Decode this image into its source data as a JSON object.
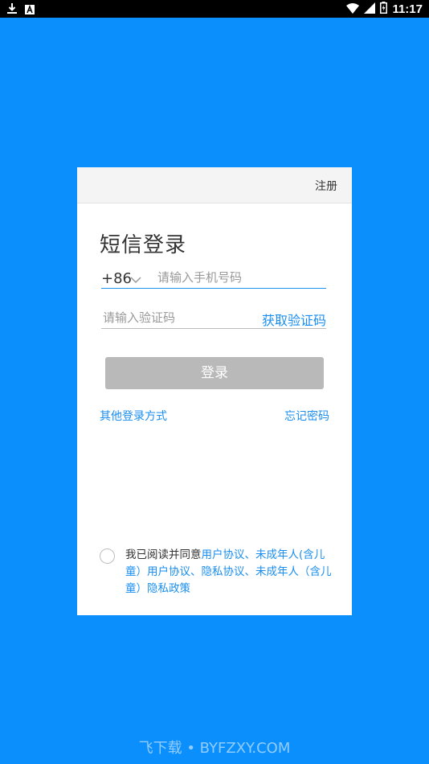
{
  "status_bar": {
    "time": "11:17",
    "icons_left": [
      "download-icon",
      "a-notification-icon"
    ],
    "icons_right": [
      "wifi-icon",
      "signal-icon",
      "battery-icon"
    ]
  },
  "card": {
    "register_label": "注册",
    "title": "短信登录",
    "phone": {
      "country_code": "+86",
      "placeholder": "请输入手机号码",
      "value": ""
    },
    "code": {
      "placeholder": "请输入验证码",
      "value": "",
      "get_code_label": "获取验证码"
    },
    "login_label": "登录",
    "other_login_label": "其他登录方式",
    "forgot_label": "忘记密码",
    "agreement": {
      "prefix": "我已阅读并同意",
      "links": "用户协议、未成年人(含儿童）用户协议、隐私协议、未成年人（含儿童）隐私政策"
    }
  },
  "watermark": "飞下载 • BYFZXY.COM",
  "colors": {
    "background": "#0a8ffd",
    "accent": "#1a8ef0",
    "button_disabled": "#b9b9b9"
  }
}
